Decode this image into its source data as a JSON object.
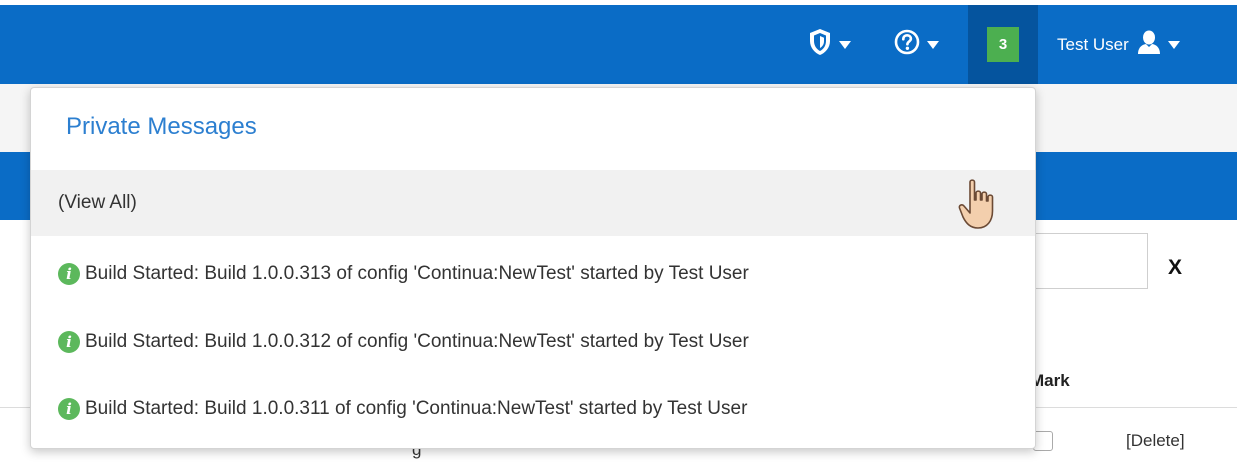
{
  "header": {
    "notification_count": "3",
    "user_name": "Test User"
  },
  "private_messages": {
    "title": "Private Messages",
    "view_all": "(View All)",
    "items": [
      {
        "icon": "info-icon",
        "text": "Build Started: Build 1.0.0.313 of config 'Continua:NewTest' started by Test User"
      },
      {
        "icon": "info-icon",
        "text": "Build Started: Build 1.0.0.312 of config 'Continua:NewTest' started by Test User"
      },
      {
        "icon": "info-icon",
        "text": "Build Started: Build 1.0.0.311 of config 'Continua:NewTest' started by Test User"
      }
    ]
  },
  "background_page": {
    "clear_label": "X",
    "column_mark": "Mark",
    "delete_label": "[Delete]",
    "partial_text": "g"
  },
  "colors": {
    "nav_blue": "#0a6cc6",
    "nav_active": "#05549e",
    "badge_green": "#4caf50",
    "link_blue": "#2c7fd0",
    "info_green": "#5cb85c"
  }
}
